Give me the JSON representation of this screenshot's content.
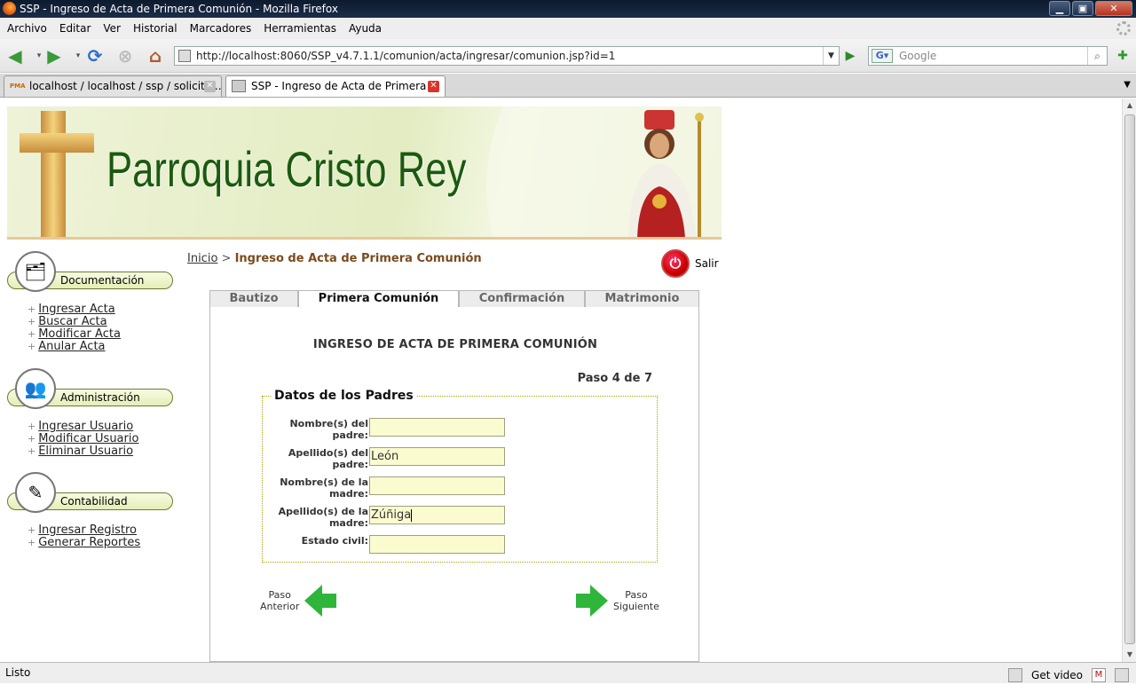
{
  "window": {
    "title": "SSP - Ingreso de Acta de Primera Comunión - Mozilla Firefox"
  },
  "menu": [
    "Archivo",
    "Editar",
    "Ver",
    "Historial",
    "Marcadores",
    "Herramientas",
    "Ayuda"
  ],
  "address": {
    "url": "http://localhost:8060/SSP_v4.7.1.1/comunion/acta/ingresar/comunion.jsp?id=1"
  },
  "search": {
    "placeholder": "Google",
    "engine_letter": "G"
  },
  "tabs": [
    {
      "label": "localhost / localhost / ssp / solicita...",
      "fav": "PMA"
    },
    {
      "label": "SSP - Ingreso de Acta de Primera ..."
    }
  ],
  "banner": {
    "title": "Parroquia Cristo Rey"
  },
  "breadcrumb": {
    "home": "Inicio",
    "sep": ">",
    "current": "Ingreso de Acta de Primera Comunión"
  },
  "logout": {
    "label": "Salir"
  },
  "sidebar": {
    "sections": [
      {
        "title": "Documentación",
        "links": [
          "Ingresar Acta",
          "Buscar Acta",
          "Modificar Acta",
          "Anular Acta"
        ]
      },
      {
        "title": "Administración",
        "links": [
          "Ingresar Usuario",
          "Modificar Usuario",
          "Eliminar Usuario"
        ]
      },
      {
        "title": "Contabilidad",
        "links": [
          "Ingresar Registro",
          "Generar Reportes"
        ]
      }
    ]
  },
  "page_tabs": [
    "Bautizo",
    "Primera Comunión",
    "Confirmación",
    "Matrimonio"
  ],
  "form": {
    "heading": "INGRESO DE ACTA DE PRIMERA COMUNIÓN",
    "step": "Paso 4 de 7",
    "legend": "Datos de los Padres",
    "fields": [
      {
        "label_1": "Nombre(s) del",
        "label_2": "padre:",
        "value": ""
      },
      {
        "label_1": "Apellido(s) del",
        "label_2": "padre:",
        "value": "León"
      },
      {
        "label_1": "Nombre(s) de la",
        "label_2": "madre:",
        "value": ""
      },
      {
        "label_1": "Apellido(s) de la",
        "label_2": "madre:",
        "value": "Zúñiga"
      },
      {
        "label_1": "Estado civil:",
        "label_2": "",
        "value": ""
      }
    ],
    "prev": {
      "l1": "Paso",
      "l2": "Anterior"
    },
    "next": {
      "l1": "Paso",
      "l2": "Siguiente"
    }
  },
  "status": {
    "text": "Listo",
    "getvideo": "Get video"
  }
}
